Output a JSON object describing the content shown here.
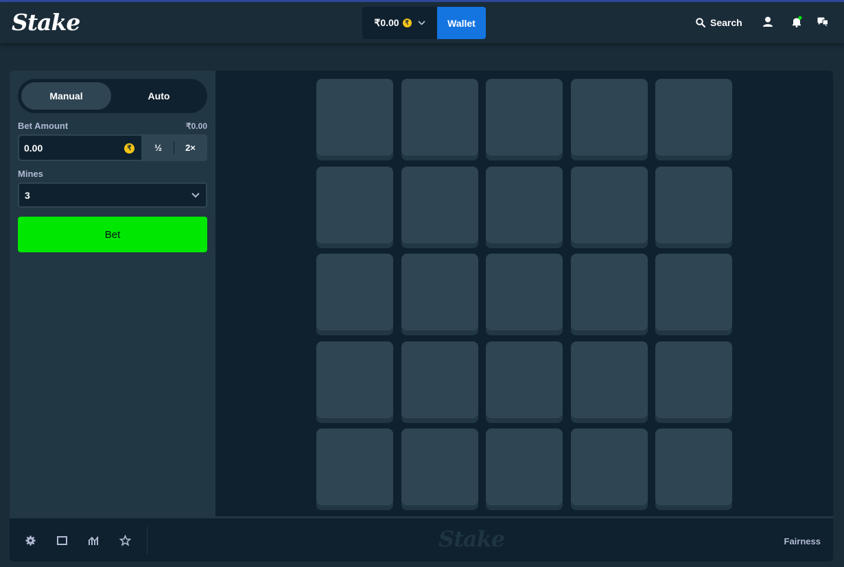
{
  "header": {
    "logo": "Stake",
    "balance": "₹0.00",
    "wallet_label": "Wallet",
    "search_label": "Search"
  },
  "controls": {
    "tabs": [
      "Manual",
      "Auto"
    ],
    "bet_amount_label": "Bet Amount",
    "bet_amount_converted": "₹0.00",
    "bet_amount_value": "0.00",
    "half_label": "½",
    "double_label": "2×",
    "mines_label": "Mines",
    "mines_value": "3",
    "bet_button": "Bet"
  },
  "board": {
    "rows": 5,
    "cols": 5
  },
  "footer": {
    "logo": "Stake",
    "fairness_label": "Fairness"
  },
  "colors": {
    "accent_blue": "#1475e1",
    "bet_green": "#00e701",
    "coin_gold": "#f5c518",
    "tile": "#2f4553",
    "background": "#0f212e"
  }
}
